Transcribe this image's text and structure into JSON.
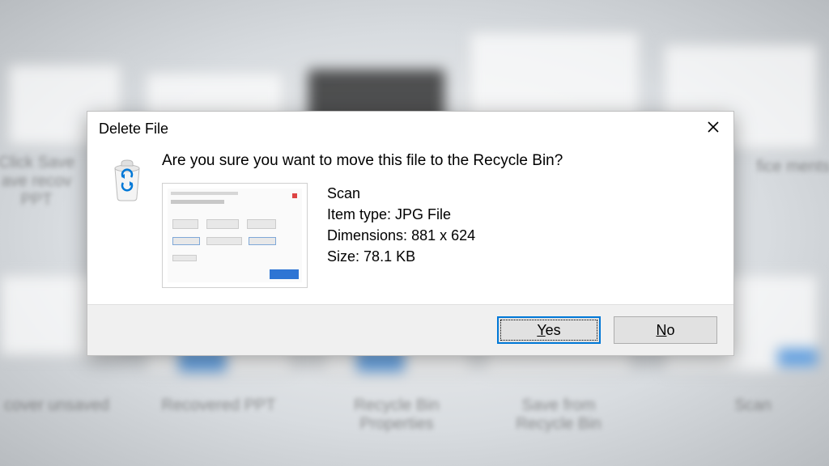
{
  "dialog": {
    "title": "Delete File",
    "question": "Are you sure you want to move this file to the Recycle Bin?",
    "filename": "Scan",
    "item_type_label": "Item type:",
    "item_type_value": "JPG File",
    "dimensions_label": "Dimensions:",
    "dimensions_value": "881 x 624",
    "size_label": "Size:",
    "size_value": "78.1 KB",
    "yes_label": "Yes",
    "no_label": "No"
  },
  "bg": {
    "labels": [
      "Click Save\nave recov\nPPT",
      "fice\nments",
      "cover unsaved",
      "Recovered PPT",
      "Recycle Bin\nProperties",
      "Save from\nRecycle Bin",
      "Scan"
    ]
  }
}
